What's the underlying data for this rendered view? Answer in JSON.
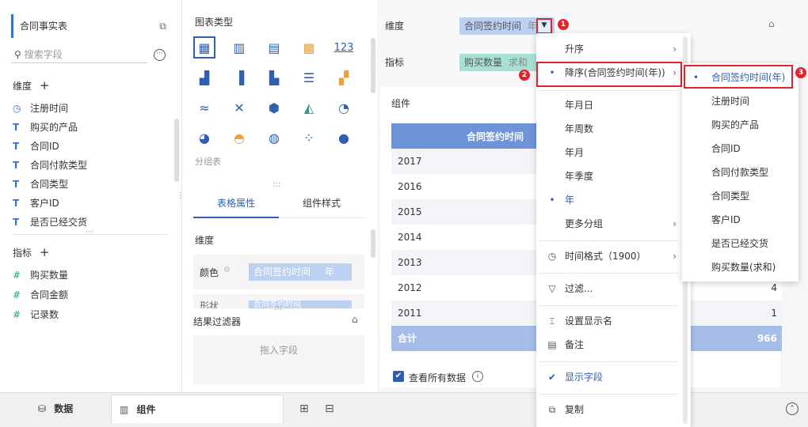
{
  "left": {
    "dataset_title": "合同事实表",
    "search_placeholder": "搜索字段",
    "dim_section": "维度",
    "dims": [
      {
        "type": "clock",
        "label": "注册时间"
      },
      {
        "type": "T",
        "label": "购买的产品"
      },
      {
        "type": "T",
        "label": "合同ID"
      },
      {
        "type": "T",
        "label": "合同付款类型"
      },
      {
        "type": "T",
        "label": "合同类型"
      },
      {
        "type": "T",
        "label": "客户ID"
      },
      {
        "type": "T",
        "label": "是否已经交货"
      }
    ],
    "metric_section": "指标",
    "metrics": [
      {
        "type": "#",
        "label": "购买数量"
      },
      {
        "type": "#",
        "label": "合同金额"
      },
      {
        "type": "#",
        "label": "记录数"
      }
    ]
  },
  "mid": {
    "chart_type_title": "图表类型",
    "group_label": "分组表",
    "tabs": [
      "表格属性",
      "组件样式"
    ],
    "dim_label": "维度",
    "color_label": "颜色",
    "color_pill": "合同签约时间",
    "color_pill_suffix": "年",
    "shape_label": "形状",
    "result_filter": "结果过滤器",
    "drop_hint": "拖入字段"
  },
  "right": {
    "dim_label": "维度",
    "dim_pill": "合同签约时间",
    "dim_pill_suffix": "年",
    "metric_label": "指标",
    "metric_pill": "购买数量",
    "metric_pill_suffix": "求和",
    "component_label": "组件",
    "table_header": "合同签约时间",
    "rows": [
      {
        "year": "2017",
        "value": ""
      },
      {
        "year": "2016",
        "value": ""
      },
      {
        "year": "2015",
        "value": ""
      },
      {
        "year": "2014",
        "value": ""
      },
      {
        "year": "2013",
        "value": ""
      },
      {
        "year": "2012",
        "value": "4"
      },
      {
        "year": "2011",
        "value": "1"
      }
    ],
    "total_label": "合计",
    "total_value": "966",
    "show_all_data": "查看所有数据"
  },
  "bottom": {
    "data_tab": "数据",
    "component_tab": "组件"
  },
  "menu": {
    "items": [
      {
        "label": "升序",
        "has_sub": true
      },
      {
        "label": "降序(合同签约时间(年))",
        "has_sub": true,
        "dot": true
      },
      {
        "label": "年月日"
      },
      {
        "label": "年周数"
      },
      {
        "label": "年月"
      },
      {
        "label": "年季度"
      },
      {
        "label": "年",
        "dot": true
      },
      {
        "label": "更多分组",
        "has_sub": true
      },
      {
        "label": "时间格式（1900）",
        "has_sub": true
      },
      {
        "label": "过滤..."
      },
      {
        "label": "设置显示名"
      },
      {
        "label": "备注"
      },
      {
        "label": "显示字段"
      },
      {
        "label": "复制"
      }
    ]
  },
  "submenu": {
    "items": [
      "合同签约时间(年)",
      "注册时间",
      "购买的产品",
      "合同ID",
      "合同付款类型",
      "合同类型",
      "客户ID",
      "是否已经交货",
      "购买数量(求和)"
    ]
  },
  "badges": [
    "1",
    "2",
    "3"
  ],
  "colors": {
    "accent": "#2f5fae",
    "header": "#6f93d7",
    "pill": "#bcd0f2",
    "metric_pill": "#a8e0d6",
    "red": "#e0252c"
  }
}
